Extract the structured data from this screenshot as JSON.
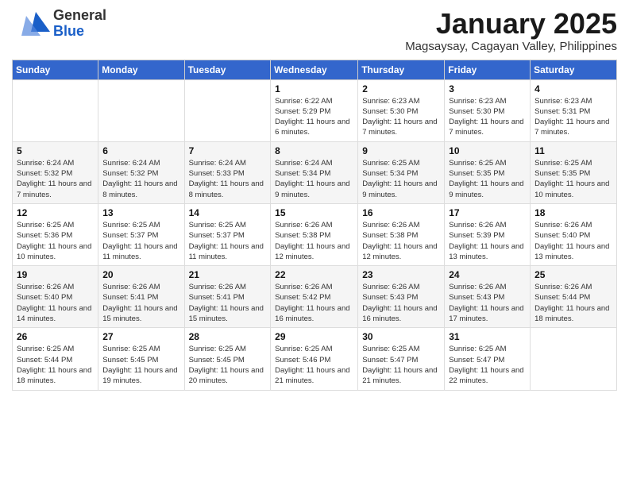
{
  "header": {
    "logo_general": "General",
    "logo_blue": "Blue",
    "month_title": "January 2025",
    "subtitle": "Magsaysay, Cagayan Valley, Philippines"
  },
  "days_of_week": [
    "Sunday",
    "Monday",
    "Tuesday",
    "Wednesday",
    "Thursday",
    "Friday",
    "Saturday"
  ],
  "weeks": [
    [
      {
        "day": "",
        "info": ""
      },
      {
        "day": "",
        "info": ""
      },
      {
        "day": "",
        "info": ""
      },
      {
        "day": "1",
        "info": "Sunrise: 6:22 AM\nSunset: 5:29 PM\nDaylight: 11 hours and 6 minutes."
      },
      {
        "day": "2",
        "info": "Sunrise: 6:23 AM\nSunset: 5:30 PM\nDaylight: 11 hours and 7 minutes."
      },
      {
        "day": "3",
        "info": "Sunrise: 6:23 AM\nSunset: 5:30 PM\nDaylight: 11 hours and 7 minutes."
      },
      {
        "day": "4",
        "info": "Sunrise: 6:23 AM\nSunset: 5:31 PM\nDaylight: 11 hours and 7 minutes."
      }
    ],
    [
      {
        "day": "5",
        "info": "Sunrise: 6:24 AM\nSunset: 5:32 PM\nDaylight: 11 hours and 7 minutes."
      },
      {
        "day": "6",
        "info": "Sunrise: 6:24 AM\nSunset: 5:32 PM\nDaylight: 11 hours and 8 minutes."
      },
      {
        "day": "7",
        "info": "Sunrise: 6:24 AM\nSunset: 5:33 PM\nDaylight: 11 hours and 8 minutes."
      },
      {
        "day": "8",
        "info": "Sunrise: 6:24 AM\nSunset: 5:34 PM\nDaylight: 11 hours and 9 minutes."
      },
      {
        "day": "9",
        "info": "Sunrise: 6:25 AM\nSunset: 5:34 PM\nDaylight: 11 hours and 9 minutes."
      },
      {
        "day": "10",
        "info": "Sunrise: 6:25 AM\nSunset: 5:35 PM\nDaylight: 11 hours and 9 minutes."
      },
      {
        "day": "11",
        "info": "Sunrise: 6:25 AM\nSunset: 5:35 PM\nDaylight: 11 hours and 10 minutes."
      }
    ],
    [
      {
        "day": "12",
        "info": "Sunrise: 6:25 AM\nSunset: 5:36 PM\nDaylight: 11 hours and 10 minutes."
      },
      {
        "day": "13",
        "info": "Sunrise: 6:25 AM\nSunset: 5:37 PM\nDaylight: 11 hours and 11 minutes."
      },
      {
        "day": "14",
        "info": "Sunrise: 6:25 AM\nSunset: 5:37 PM\nDaylight: 11 hours and 11 minutes."
      },
      {
        "day": "15",
        "info": "Sunrise: 6:26 AM\nSunset: 5:38 PM\nDaylight: 11 hours and 12 minutes."
      },
      {
        "day": "16",
        "info": "Sunrise: 6:26 AM\nSunset: 5:38 PM\nDaylight: 11 hours and 12 minutes."
      },
      {
        "day": "17",
        "info": "Sunrise: 6:26 AM\nSunset: 5:39 PM\nDaylight: 11 hours and 13 minutes."
      },
      {
        "day": "18",
        "info": "Sunrise: 6:26 AM\nSunset: 5:40 PM\nDaylight: 11 hours and 13 minutes."
      }
    ],
    [
      {
        "day": "19",
        "info": "Sunrise: 6:26 AM\nSunset: 5:40 PM\nDaylight: 11 hours and 14 minutes."
      },
      {
        "day": "20",
        "info": "Sunrise: 6:26 AM\nSunset: 5:41 PM\nDaylight: 11 hours and 15 minutes."
      },
      {
        "day": "21",
        "info": "Sunrise: 6:26 AM\nSunset: 5:41 PM\nDaylight: 11 hours and 15 minutes."
      },
      {
        "day": "22",
        "info": "Sunrise: 6:26 AM\nSunset: 5:42 PM\nDaylight: 11 hours and 16 minutes."
      },
      {
        "day": "23",
        "info": "Sunrise: 6:26 AM\nSunset: 5:43 PM\nDaylight: 11 hours and 16 minutes."
      },
      {
        "day": "24",
        "info": "Sunrise: 6:26 AM\nSunset: 5:43 PM\nDaylight: 11 hours and 17 minutes."
      },
      {
        "day": "25",
        "info": "Sunrise: 6:26 AM\nSunset: 5:44 PM\nDaylight: 11 hours and 18 minutes."
      }
    ],
    [
      {
        "day": "26",
        "info": "Sunrise: 6:25 AM\nSunset: 5:44 PM\nDaylight: 11 hours and 18 minutes."
      },
      {
        "day": "27",
        "info": "Sunrise: 6:25 AM\nSunset: 5:45 PM\nDaylight: 11 hours and 19 minutes."
      },
      {
        "day": "28",
        "info": "Sunrise: 6:25 AM\nSunset: 5:45 PM\nDaylight: 11 hours and 20 minutes."
      },
      {
        "day": "29",
        "info": "Sunrise: 6:25 AM\nSunset: 5:46 PM\nDaylight: 11 hours and 21 minutes."
      },
      {
        "day": "30",
        "info": "Sunrise: 6:25 AM\nSunset: 5:47 PM\nDaylight: 11 hours and 21 minutes."
      },
      {
        "day": "31",
        "info": "Sunrise: 6:25 AM\nSunset: 5:47 PM\nDaylight: 11 hours and 22 minutes."
      },
      {
        "day": "",
        "info": ""
      }
    ]
  ]
}
